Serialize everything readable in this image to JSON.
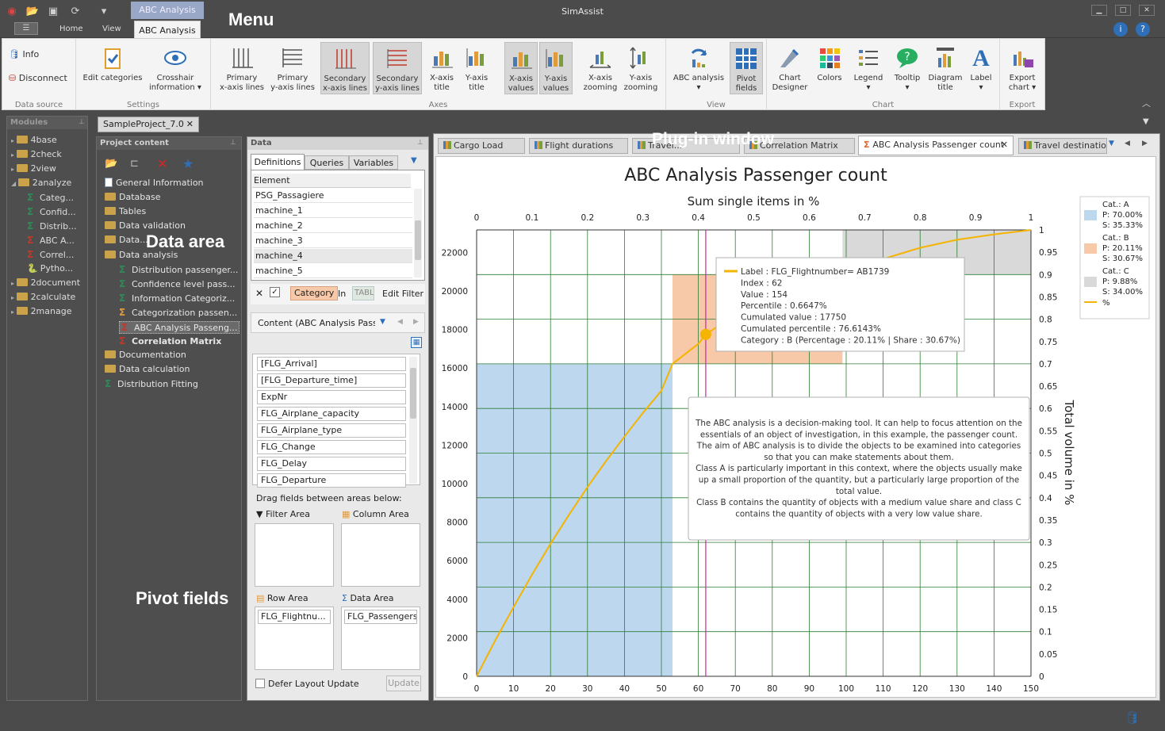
{
  "app": {
    "title": "SimAssist",
    "context_tab": "ABC Analysis"
  },
  "ribbon_tabs": {
    "home": "Home",
    "view": "View",
    "active": "ABC Analysis"
  },
  "overlays": {
    "menu": "Menu",
    "plugin": "Plug-in window",
    "data_area": "Data area",
    "pivot": "Pivot fields"
  },
  "ribbon": {
    "datasource": {
      "label": "Data source",
      "info": "Info",
      "disconnect": "Disconnect"
    },
    "settings": {
      "label": "Settings",
      "edit_categories": "Edit categories",
      "crosshair1": "Crosshair",
      "crosshair2": "information ▾"
    },
    "axes": {
      "label": "Axes",
      "b1a": "Primary",
      "b1b": "x-axis lines",
      "b2a": "Primary",
      "b2b": "y-axis lines",
      "b3a": "Secondary",
      "b3b": "x-axis lines",
      "b4a": "Secondary",
      "b4b": "y-axis lines",
      "b5a": "X-axis",
      "b5b": "title",
      "b6a": "Y-axis",
      "b6b": "title",
      "b7a": "X-axis",
      "b7b": "values",
      "b8a": "Y-axis",
      "b8b": "values",
      "b9a": "X-axis",
      "b9b": "zooming",
      "b10a": "Y-axis",
      "b10b": "zooming"
    },
    "view": {
      "label": "View",
      "abc": "ABC analysis",
      "pivot1": "Pivot",
      "pivot2": "fields"
    },
    "chart": {
      "label": "Chart",
      "designer1": "Chart",
      "designer2": "Designer",
      "colors": "Colors",
      "legend": "Legend",
      "tooltip": "Tooltip",
      "diag1": "Diagram",
      "diag2": "title",
      "label_btn": "Label"
    },
    "export": {
      "label": "Export",
      "exp1": "Export",
      "exp2": "chart ▾"
    }
  },
  "modules": {
    "header": "Modules",
    "items": [
      "4base",
      "2check",
      "2view",
      "2analyze",
      "Categ...",
      "Confid...",
      "Distrib...",
      "ABC A...",
      "Correl...",
      "Pytho...",
      "2document",
      "2calculate",
      "2manage"
    ]
  },
  "project_tab": "SampleProject_7.0",
  "project": {
    "header": "Project content",
    "items": [
      "General Information",
      "Database",
      "Tables",
      "Data validation",
      "Data...",
      "Data analysis",
      "Distribution passenger...",
      "Confidence level pass...",
      "Information Categoriz...",
      "Categorization passen...",
      "ABC Analysis Passeng...",
      "Correlation Matrix",
      "Documentation",
      "Data calculation",
      "Distribution Fitting"
    ]
  },
  "data_panel": {
    "header": "Data",
    "tabs": [
      "Definitions",
      "Queries",
      "Variables"
    ],
    "column": "Element",
    "rows": [
      "PSG_Passagiere",
      "machine_1",
      "machine_2",
      "machine_3",
      "machine_4",
      "machine_5"
    ],
    "filter_category": "Category",
    "filter_in": "In",
    "filter_table": "TABL",
    "edit_filter": "Edit Filter",
    "content_title": "Content (ABC Analysis Passen",
    "fields": [
      "[FLG_Arrival]",
      "[FLG_Departure_time]",
      "ExpNr",
      "FLG_Airplane_capacity",
      "FLG_Airplane_type",
      "FLG_Change",
      "FLG_Delay",
      "FLG_Departure"
    ],
    "drag_hint": "Drag fields between areas below:",
    "filter_area": "Filter Area",
    "column_area": "Column Area",
    "row_area": "Row Area",
    "data_area": "Data Area",
    "row_field": "FLG_Flightnu...",
    "data_field": "FLG_Passengers",
    "defer": "Defer Layout Update",
    "update": "Update"
  },
  "doc_tabs": [
    "Cargo Load",
    "Flight durations",
    "Travel...",
    "Correlation Matrix",
    "ABC Analysis Passenger count",
    "Travel destination"
  ],
  "chart_data": {
    "type": "line",
    "title": "ABC Analysis Passenger count",
    "top_axis_title": "Sum single items in %",
    "right_axis_title": "Total volume in %",
    "x_ticks": [
      0,
      10,
      20,
      30,
      40,
      50,
      60,
      70,
      80,
      90,
      100,
      110,
      120,
      130,
      140,
      150
    ],
    "top_ticks": [
      0,
      0.1,
      0.2,
      0.3,
      0.4,
      0.5,
      0.6,
      0.7,
      0.8,
      0.9,
      1
    ],
    "top_tick_labels": [
      "0",
      "0.1",
      "0.2",
      "0.3",
      "0.4",
      "0.5",
      "0.6",
      "0.7",
      "0.8",
      "0.9",
      "1"
    ],
    "left_ticks": [
      0,
      2000,
      4000,
      6000,
      8000,
      10000,
      12000,
      14000,
      16000,
      18000,
      20000,
      22000
    ],
    "right_ticks": [
      0,
      0.05,
      0.1,
      0.15,
      0.2,
      0.25,
      0.3,
      0.35,
      0.4,
      0.45,
      0.5,
      0.55,
      0.6,
      0.65,
      0.7,
      0.75,
      0.8,
      0.85,
      0.9,
      0.95,
      1
    ],
    "right_tick_labels": [
      "0",
      "0.05",
      "0.1",
      "0.15",
      "0.2",
      "0.25",
      "0.3",
      "0.35",
      "0.4",
      "0.45",
      "0.5",
      "0.55",
      "0.6",
      "0.65",
      "0.7",
      "0.75",
      "0.8",
      "0.85",
      "0.9",
      "0.95",
      "1"
    ],
    "xlim": [
      0,
      150
    ],
    "ylim_left": [
      0,
      23170
    ],
    "ylim_right": [
      0,
      1
    ],
    "categories_regions": [
      {
        "name": "A",
        "x": [
          0,
          53
        ],
        "y": [
          0,
          0.7
        ],
        "color": "#bcd7ee"
      },
      {
        "name": "B",
        "x": [
          53,
          99
        ],
        "y": [
          0.7,
          0.9
        ],
        "color": "#f7c9a9"
      },
      {
        "name": "C",
        "x": [
          99,
          150
        ],
        "y": [
          0.9,
          1
        ],
        "color": "#d9d9d9"
      }
    ],
    "series": [
      {
        "name": "%",
        "color": "#f5b400",
        "x": [
          0,
          5,
          10,
          15,
          20,
          25,
          30,
          35,
          40,
          45,
          50,
          53,
          60,
          62,
          70,
          80,
          90,
          99,
          110,
          120,
          130,
          140,
          150
        ],
        "y": [
          0,
          0.08,
          0.155,
          0.228,
          0.297,
          0.362,
          0.424,
          0.482,
          0.537,
          0.59,
          0.64,
          0.7,
          0.745,
          0.766,
          0.81,
          0.855,
          0.89,
          0.9,
          0.935,
          0.96,
          0.978,
          0.99,
          1
        ]
      }
    ],
    "crosshair_x": 62,
    "highlight_point": {
      "x": 62,
      "y": 0.766
    },
    "legend": [
      {
        "title": "Cat.: A",
        "p": "P: 70.00%",
        "s": "S: 35.33%",
        "color": "#bcd7ee"
      },
      {
        "title": "Cat.: B",
        "p": "P: 20.11%",
        "s": "S: 30.67%",
        "color": "#f7c9a9"
      },
      {
        "title": "Cat.: C",
        "p": "P: 9.88%",
        "s": "S: 34.00%",
        "color": "#d9d9d9"
      },
      {
        "title": "%",
        "color": "#f5b400"
      }
    ],
    "tooltip": {
      "label": "Label : FLG_Flightnumber= AB1739",
      "index": "Index : 62",
      "value": "Value : 154",
      "percentile": "Percentile : 0.6647%",
      "cum_value": "Cumulated value : 17750",
      "cum_pct": "Cumulated percentile : 76.6143%",
      "category": "Category : B (Percentage : 20.11% | Share : 30.67%)"
    },
    "note": [
      "The ABC analysis is a decision-making tool. It can help to focus attention on the",
      "essentials of an object of investigation, in this example, the passenger count.",
      "The aim of ABC analysis is to divide the objects to be examined into categories",
      "so that you can make statements about them.",
      "Class A is particularly important in this context, where the objects usually make",
      "up a small proportion of the quantity, but a particularly large proportion of the",
      "total value.",
      "Class B contains the quantity of objects with a medium value share and class C",
      "contains the quantity of objects with a very low value share."
    ]
  }
}
